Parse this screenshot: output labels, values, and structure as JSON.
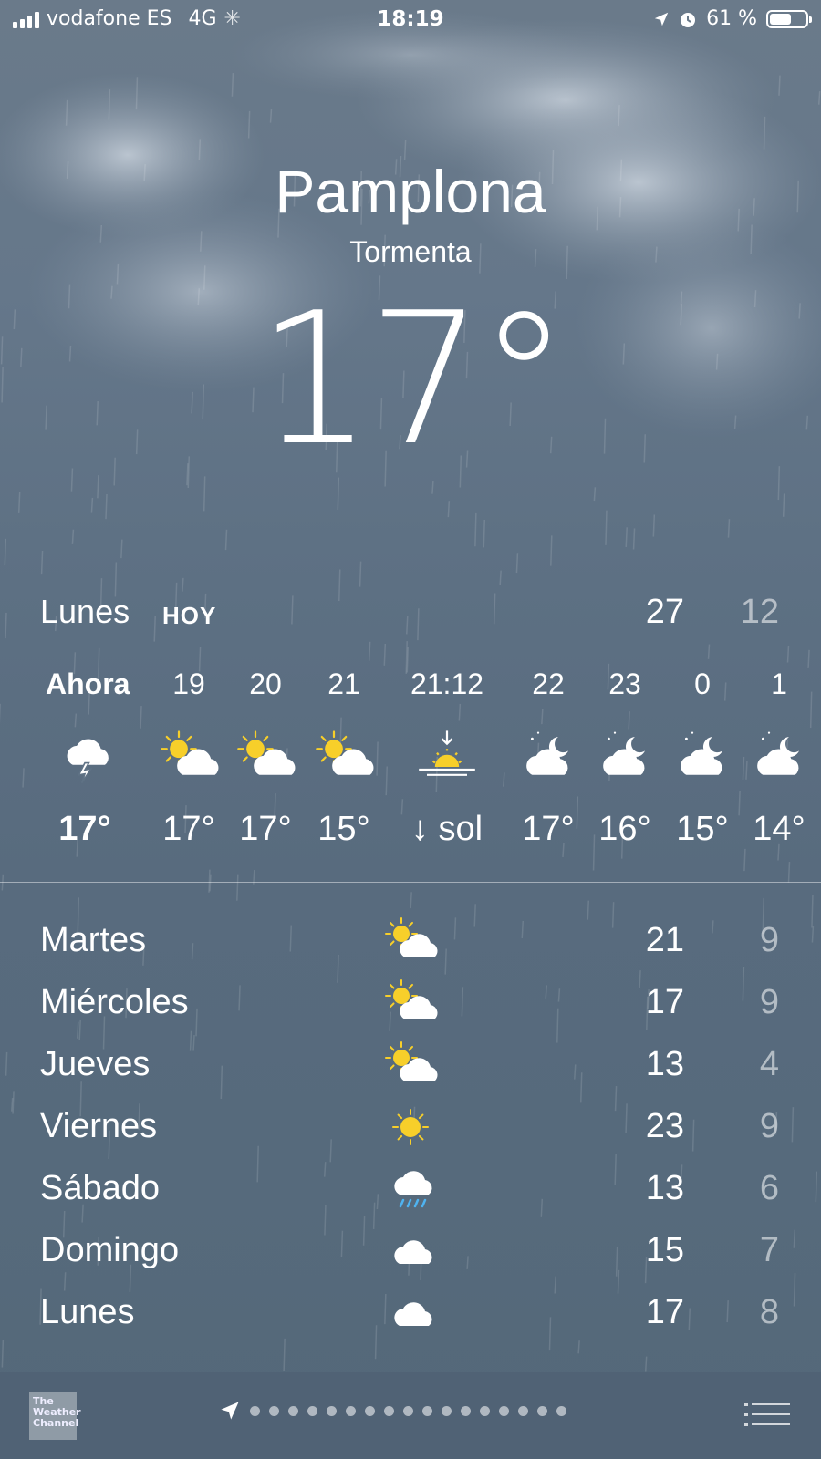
{
  "status_bar": {
    "carrier": "vodafone ES",
    "network": "4G",
    "time": "18:19",
    "battery": "61 %",
    "battery_level": 0.61
  },
  "location": {
    "city": "Pamplona",
    "condition": "Tormenta",
    "temperature": "17°"
  },
  "today": {
    "day": "Lunes",
    "label": "HOY",
    "high": "27",
    "low": "12"
  },
  "hourly": [
    {
      "time": "Ahora",
      "icon": "thunderstorm-icon",
      "temp": "17°"
    },
    {
      "time": "19",
      "icon": "partly-sunny-icon",
      "temp": "17°"
    },
    {
      "time": "20",
      "icon": "partly-sunny-icon",
      "temp": "17°"
    },
    {
      "time": "21",
      "icon": "partly-sunny-icon",
      "temp": "15°"
    },
    {
      "time": "21:12",
      "icon": "sunset-icon",
      "temp": "↓ sol"
    },
    {
      "time": "22",
      "icon": "partly-cloudy-night-icon",
      "temp": "17°"
    },
    {
      "time": "23",
      "icon": "partly-cloudy-night-icon",
      "temp": "16°"
    },
    {
      "time": "0",
      "icon": "partly-cloudy-night-icon",
      "temp": "15°"
    },
    {
      "time": "1",
      "icon": "partly-cloudy-night-icon",
      "temp": "14°"
    }
  ],
  "daily": [
    {
      "day": "Martes",
      "icon": "partly-sunny-icon",
      "high": "21",
      "low": "9"
    },
    {
      "day": "Miércoles",
      "icon": "partly-sunny-icon",
      "high": "17",
      "low": "9"
    },
    {
      "day": "Jueves",
      "icon": "partly-sunny-icon",
      "high": "13",
      "low": "4"
    },
    {
      "day": "Viernes",
      "icon": "sun-icon",
      "high": "23",
      "low": "9"
    },
    {
      "day": "Sábado",
      "icon": "rain-icon",
      "high": "13",
      "low": "6"
    },
    {
      "day": "Domingo",
      "icon": "cloud-icon",
      "high": "15",
      "low": "7"
    },
    {
      "day": "Lunes",
      "icon": "cloud-icon",
      "high": "17",
      "low": "8"
    }
  ],
  "bottom_bar": {
    "logo_text": "The Weather Channel",
    "page_dots": 17
  },
  "colors": {
    "sun": "#f7cf2a",
    "rain": "#4fb3f0"
  }
}
